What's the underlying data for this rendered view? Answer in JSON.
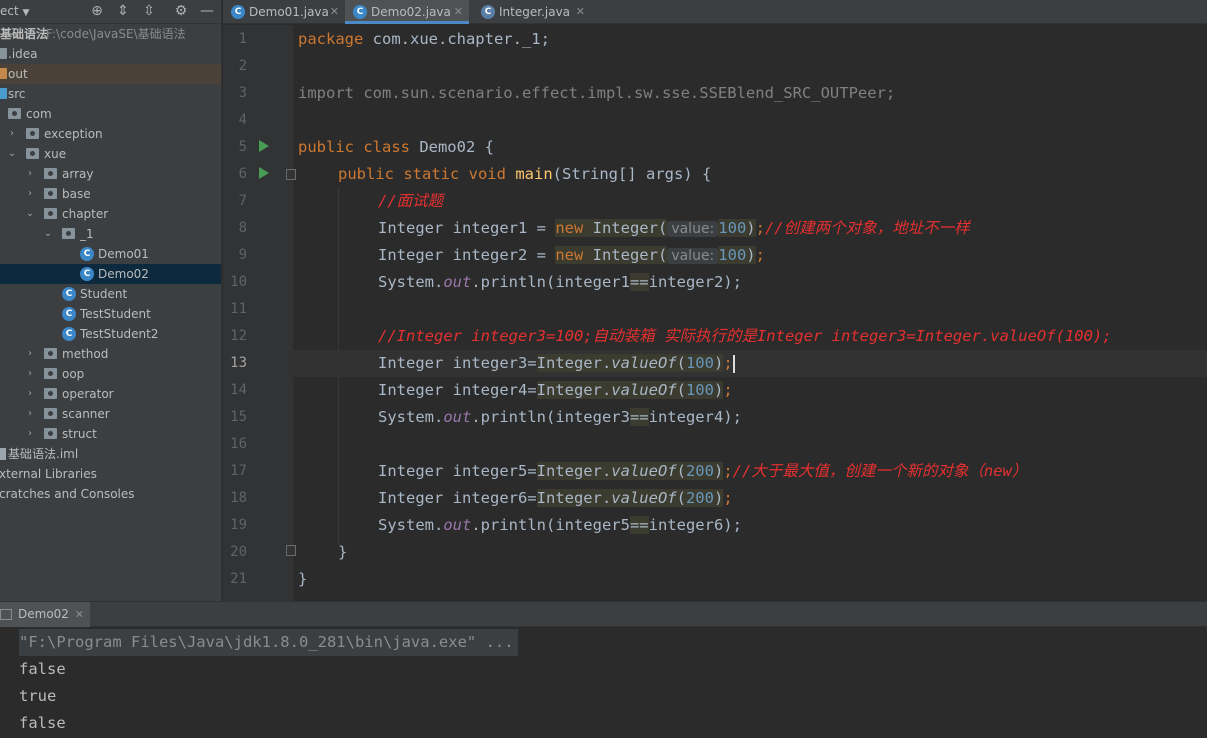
{
  "project_panel": {
    "title": "ect",
    "tree": [
      {
        "label": "基础语法",
        "hint": "F:\\code\\JavaSE\\基础语法",
        "kind": "module"
      },
      {
        "label": ".idea",
        "kind": "folder"
      },
      {
        "label": "out",
        "kind": "folder-out"
      },
      {
        "label": "src",
        "kind": "folder-src"
      },
      {
        "label": "com",
        "kind": "package"
      },
      {
        "label": "exception",
        "kind": "package"
      },
      {
        "label": "xue",
        "kind": "package"
      },
      {
        "label": "array",
        "kind": "package"
      },
      {
        "label": "base",
        "kind": "package"
      },
      {
        "label": "chapter",
        "kind": "package"
      },
      {
        "label": "_1",
        "kind": "package"
      },
      {
        "label": "Demo01",
        "kind": "class"
      },
      {
        "label": "Demo02",
        "kind": "class"
      },
      {
        "label": "Student",
        "kind": "class"
      },
      {
        "label": "TestStudent",
        "kind": "class"
      },
      {
        "label": "TestStudent2",
        "kind": "class"
      },
      {
        "label": "method",
        "kind": "package"
      },
      {
        "label": "oop",
        "kind": "package"
      },
      {
        "label": "operator",
        "kind": "package"
      },
      {
        "label": "scanner",
        "kind": "package"
      },
      {
        "label": "struct",
        "kind": "package"
      },
      {
        "label": "基础语法.iml",
        "kind": "iml"
      },
      {
        "label": "xternal Libraries",
        "kind": "lib"
      },
      {
        "label": "cratches and Consoles",
        "kind": "scratch"
      }
    ]
  },
  "editor_tabs": [
    {
      "label": "Demo01.java"
    },
    {
      "label": "Demo02.java"
    },
    {
      "label": "Integer.java"
    }
  ],
  "code": {
    "line_numbers": [
      "1",
      "2",
      "3",
      "4",
      "5",
      "6",
      "7",
      "8",
      "9",
      "10",
      "11",
      "12",
      "13",
      "14",
      "15",
      "16",
      "17",
      "18",
      "19",
      "20",
      "21"
    ],
    "l1_kw": "package",
    "l1_rest": " com.xue.chapter._1;",
    "l3": "import com.sun.scenario.effect.impl.sw.sse.SSEBlend_SRC_OUTPeer;",
    "l5_kw": "public class",
    "l5_rest": " Demo02 {",
    "l6_kw": "public static void",
    "l6_fn": "main",
    "l6_rest": "(String[] args) {",
    "l7_comment": "//面试题",
    "l8_a": "Integer integer1 = ",
    "l9_a": "Integer integer2 = ",
    "new_kw": "new",
    "integer_open": " Integer(",
    "param_hint": "value:",
    "num_100": "100",
    "num_200": "200",
    "close_semi": ");",
    "close_paren": ")",
    "semi": ";",
    "l8_comment": "//创建两个对象，地址不一样",
    "sysout_a": "System.",
    "sysout_out": "out",
    "sysout_b": ".println(integer1",
    "sysout_c": "integer2);",
    "eqeq": "==",
    "l12_comment": "//Integer integer3=100;自动装箱 实际执行的是Integer integer3=Integer.valueOf(100);",
    "l13_a": "Integer integer3=",
    "l14_a": "Integer integer4=",
    "l17_a": "Integer integer5=",
    "l18_a": "Integer integer6=",
    "integer_dot": "Integer.",
    "valueof": "valueOf",
    "open_paren": "(",
    "l15_b": ".println(integer3",
    "l15_c": "integer4);",
    "l19_b": ".println(integer5",
    "l19_c": "integer6);",
    "l17_comment": "//大于最大值，创建一个新的对象（new）",
    "brace": "}"
  },
  "run_panel": {
    "tab_label": "Demo02",
    "output": [
      "\"F:\\Program Files\\Java\\jdk1.8.0_281\\bin\\java.exe\" ...",
      "false",
      "true",
      "false"
    ]
  },
  "colors": {
    "keyword": "#cc7832",
    "number": "#6897bb",
    "comment": "#e53030",
    "field": "#9876aa",
    "method": "#ffc66d",
    "run_icon": "#499c54"
  }
}
